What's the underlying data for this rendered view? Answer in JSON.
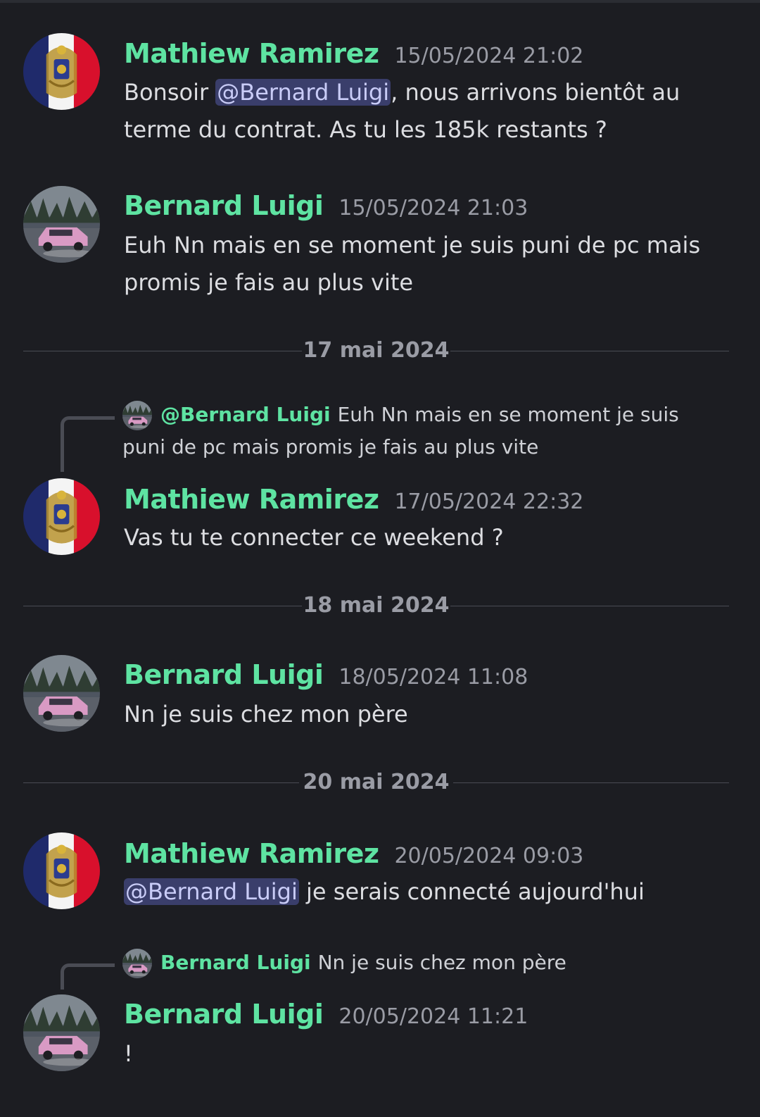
{
  "messages": [
    {
      "author": "Mathiew Ramirez",
      "timestamp": "15/05/2024 21:02",
      "text_before": "Bonsoir ",
      "mention": "@Bernard Luigi",
      "text_after": ", nous arrivons bientôt au terme du contrat. As tu les 185k restants ?"
    },
    {
      "author": "Bernard Luigi",
      "timestamp": "15/05/2024 21:03",
      "text": "Euh Nn mais en se moment je suis puni de pc mais promis je fais au plus vite"
    },
    {
      "reply_mention": "@Bernard Luigi",
      "reply_text": "Euh Nn mais en se moment je suis puni de pc mais promis je fais au plus vite",
      "author": "Mathiew Ramirez",
      "timestamp": "17/05/2024 22:32",
      "text": "Vas tu te connecter ce weekend ?"
    },
    {
      "author": "Bernard Luigi",
      "timestamp": "18/05/2024 11:08",
      "text": "Nn je suis chez mon père"
    },
    {
      "author": "Mathiew Ramirez",
      "timestamp": "20/05/2024 09:03",
      "mention": "@Bernard Luigi",
      "text_after": " je serais connecté aujourd'hui"
    },
    {
      "reply_author": "Bernard Luigi",
      "reply_text": "Nn je suis chez mon père",
      "author": "Bernard Luigi",
      "timestamp": "20/05/2024 11:21",
      "text": "!"
    }
  ],
  "dividers": [
    "17 mai 2024",
    "18 mai 2024",
    "20 mai 2024"
  ],
  "colors": {
    "background": "#1c1d22",
    "author": "#5ee3a2",
    "mention_bg": "#3a3e6b",
    "timestamp": "#9a9ca5"
  },
  "icons": {
    "avatar_mathiew": "napoleonic-coat-of-arms-on-french-flag",
    "avatar_bernard": "pink-car-in-forest"
  }
}
